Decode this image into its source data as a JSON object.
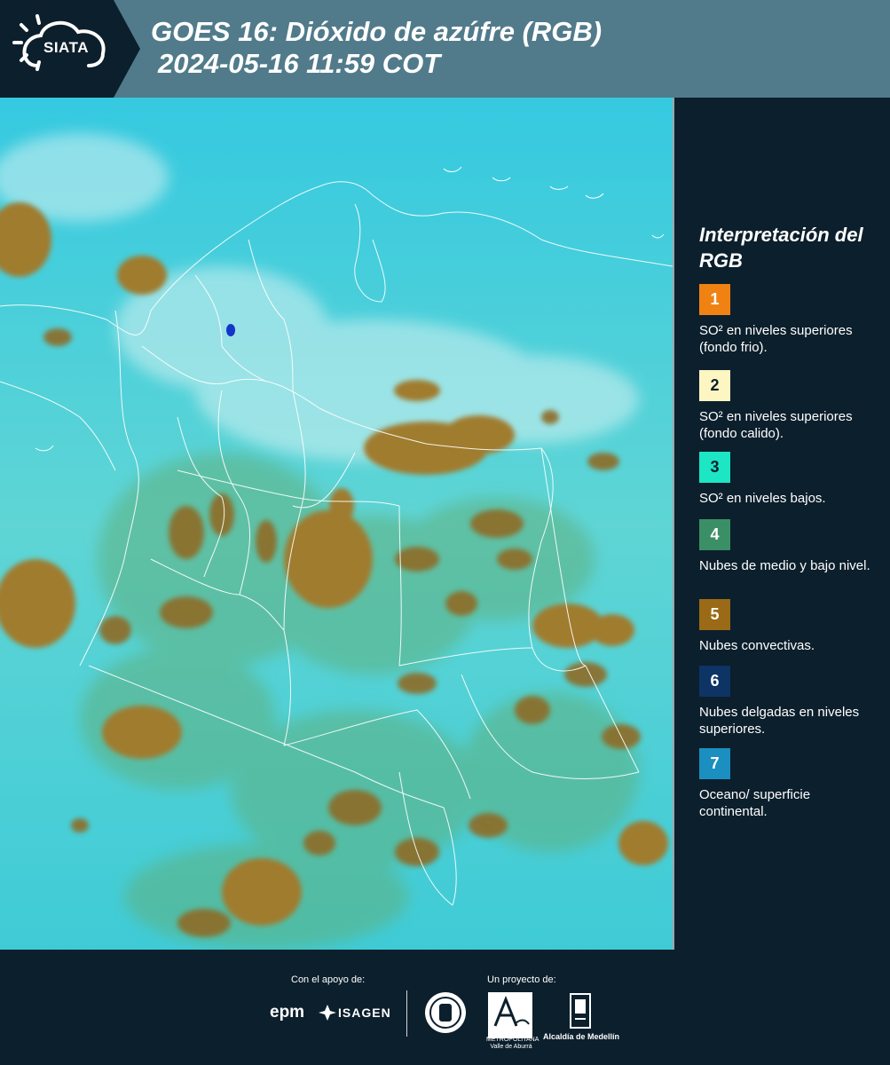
{
  "header": {
    "logo_text": "SIATA",
    "title_line1": "GOES 16: Dióxido de azúfre (RGB)",
    "title_line2": "2024-05-16 11:59 COT"
  },
  "map": {
    "icon": "satellite-map-colombia",
    "background_color": "#29c7df",
    "cloud_color": "#a07b2d"
  },
  "legend": {
    "title": "Interpretación del RGB",
    "items": [
      {
        "number": "1",
        "color": "#f08214",
        "text_color": "#ffffff",
        "label": "SO² en niveles superiores (fondo frio)."
      },
      {
        "number": "2",
        "color": "#fdf5c2",
        "text_color": "#0c1f2c",
        "label": "SO² en niveles superiores (fondo calido)."
      },
      {
        "number": "3",
        "color": "#1ce6c4",
        "text_color": "#0c1f2c",
        "label": "SO² en niveles bajos."
      },
      {
        "number": "4",
        "color": "#3b8f66",
        "text_color": "#ffffff",
        "label": "Nubes de medio y bajo nivel."
      },
      {
        "number": "5",
        "color": "#9a6a16",
        "text_color": "#ffffff",
        "label": "Nubes convectivas."
      },
      {
        "number": "6",
        "color": "#0d3465",
        "text_color": "#ffffff",
        "label": "Nubes delgadas en niveles superiores."
      },
      {
        "number": "7",
        "color": "#1a8fc0",
        "text_color": "#ffffff",
        "label": "Oceano/ superficie continental."
      }
    ]
  },
  "footer": {
    "support_label": "Con el apoyo de:",
    "project_label": "Un proyecto de:",
    "epm": "epm",
    "isagen": "ISAGEN",
    "area_logo_text": "METROPOLITANA Valle de Aburrá",
    "alcaldia": "Alcaldía de Medellín"
  }
}
